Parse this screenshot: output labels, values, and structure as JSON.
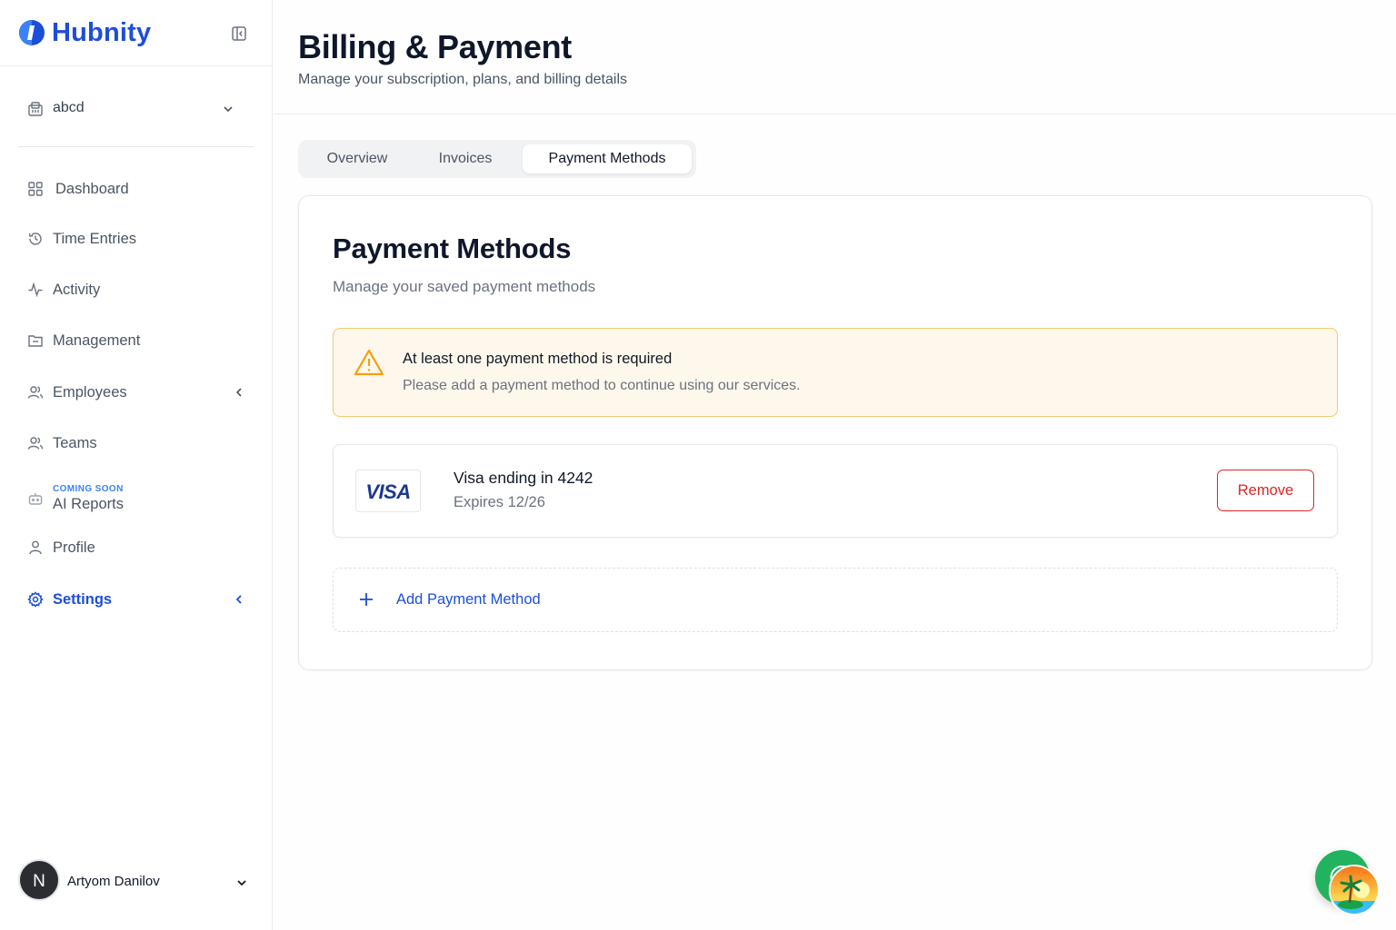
{
  "brand": {
    "name": "Hubnity",
    "accent": "#1d4ed8"
  },
  "workspace": {
    "name": "abcd"
  },
  "nav": {
    "items": [
      {
        "label": "Dashboard",
        "icon": "grid-icon"
      },
      {
        "label": "Time Entries",
        "icon": "history-icon"
      },
      {
        "label": "Activity",
        "icon": "activity-icon"
      },
      {
        "label": "Management",
        "icon": "folder-icon"
      },
      {
        "label": "Employees",
        "icon": "users-icon"
      },
      {
        "label": "Teams",
        "icon": "users-icon"
      },
      {
        "label": "AI Reports",
        "icon": "bot-icon",
        "badge": "COMING SOON"
      },
      {
        "label": "Profile",
        "icon": "user-icon"
      },
      {
        "label": "Settings",
        "icon": "gear-icon",
        "active": true
      }
    ]
  },
  "user": {
    "initial": "N",
    "name": "Artyom Danilov"
  },
  "page": {
    "title": "Billing & Payment",
    "subtitle": "Manage your subscription, plans, and billing details"
  },
  "tabs": [
    {
      "label": "Overview"
    },
    {
      "label": "Invoices"
    },
    {
      "label": "Payment Methods",
      "active": true
    }
  ],
  "card": {
    "title": "Payment Methods",
    "subtitle": "Manage your saved payment methods"
  },
  "alert": {
    "title": "At least one payment method is required",
    "text": "Please add a payment method to continue using our services."
  },
  "payment_method": {
    "brand": "VISA",
    "name": "Visa ending in 4242",
    "expires": "Expires 12/26",
    "remove_label": "Remove"
  },
  "add_method": {
    "label": "Add Payment Method"
  },
  "colors": {
    "danger": "#dc2626",
    "warning_bg": "#fef8ec",
    "warning_border": "#f5c76a",
    "fab": "#22b35e"
  }
}
